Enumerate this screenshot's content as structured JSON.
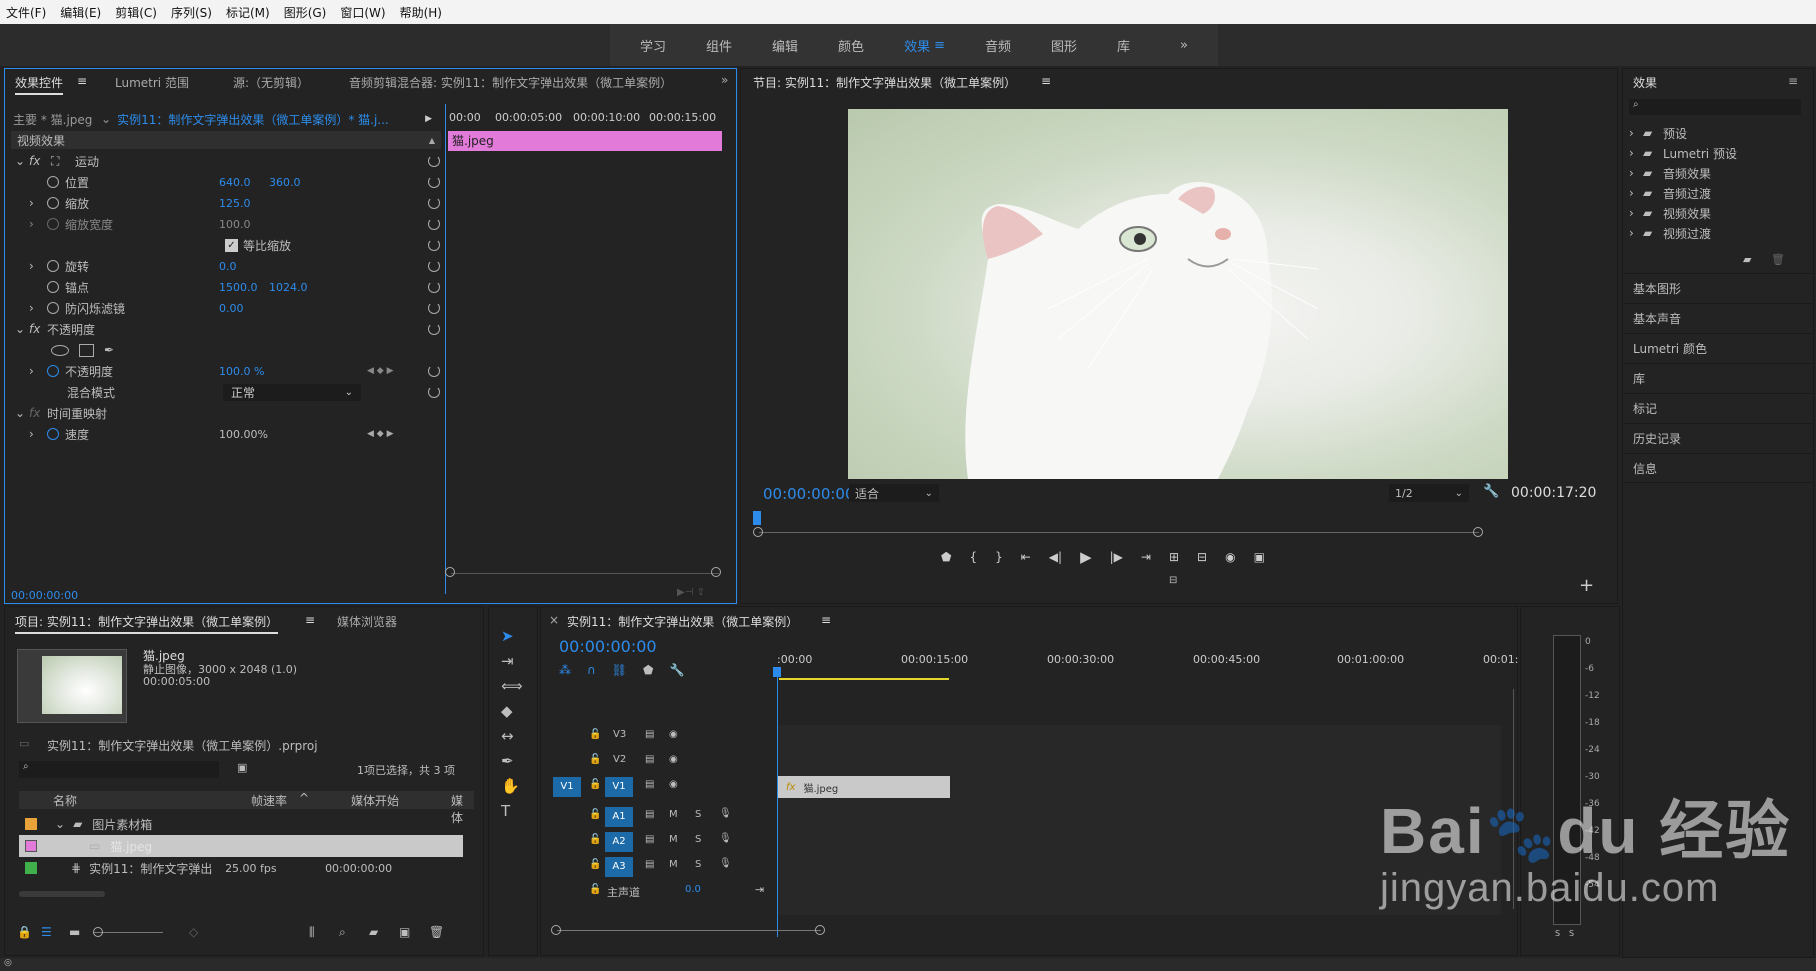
{
  "menu": [
    "文件(F)",
    "编辑(E)",
    "剪辑(C)",
    "序列(S)",
    "标记(M)",
    "图形(G)",
    "窗口(W)",
    "帮助(H)"
  ],
  "workspaces": [
    "学习",
    "组件",
    "编辑",
    "颜色",
    "效果",
    "音频",
    "图形",
    "库"
  ],
  "workspace_active": "效果",
  "ec": {
    "tabs": [
      "效果控件",
      "Lumetri 范围",
      "源:（无剪辑）",
      "音频剪辑混合器: 实例11：制作文字弹出效果（微工单案例）"
    ],
    "master": "主要 * 猫.jpeg",
    "seq": "实例11：制作文字弹出效果（微工单案例）* 猫.j...",
    "video_effects": "视频效果",
    "motion": "运动",
    "position": "位置",
    "pos_x": "640.0",
    "pos_y": "360.0",
    "scale": "缩放",
    "scale_val": "125.0",
    "scale_w": "缩放宽度",
    "scale_w_val": "100.0",
    "uniform": "等比缩放",
    "rotation": "旋转",
    "rotation_val": "0.0",
    "anchor": "锚点",
    "anchor_x": "1500.0",
    "anchor_y": "1024.0",
    "flicker": "防闪烁滤镜",
    "flicker_val": "0.00",
    "opacity_group": "不透明度",
    "opacity": "不透明度",
    "opacity_val": "100.0 %",
    "blend": "混合模式",
    "blend_val": "正常",
    "timeremap": "时间重映射",
    "speed": "速度",
    "speed_val": "100.00%",
    "timecode": "00:00:00:00",
    "ruler": [
      "00:00",
      "00:00:05:00",
      "00:00:10:00",
      "00:00:15:00"
    ],
    "clip": "猫.jpeg"
  },
  "program": {
    "title": "节目: 实例11：制作文字弹出效果（微工单案例）",
    "tc": "00:00:00:00",
    "fit": "适合",
    "res": "1/2",
    "dur": "00:00:17:20"
  },
  "effects": {
    "title": "效果",
    "items": [
      "预设",
      "Lumetri 预设",
      "音频效果",
      "音频过渡",
      "视频效果",
      "视频过渡"
    ],
    "panels": [
      "基本图形",
      "基本声音",
      "Lumetri 颜色",
      "库",
      "标记",
      "历史记录",
      "信息"
    ]
  },
  "project": {
    "tabs": [
      "项目: 实例11：制作文字弹出效果（微工单案例）",
      "媒体浏览器"
    ],
    "file": "猫.jpeg",
    "info1": "静止图像，3000 x 2048 (1.0)",
    "info2": "00:00:05:00",
    "prproj": "实例11：制作文字弹出效果（微工单案例）.prproj",
    "count": "1项已选择，共 3 项",
    "cols": [
      "名称",
      "帧速率",
      "媒体开始",
      "媒体"
    ],
    "rows": [
      {
        "name": "图片素材箱",
        "fps": "",
        "start": "",
        "color": "#e8a23a"
      },
      {
        "name": "猫.jpeg",
        "fps": "",
        "start": "",
        "color": "#e27ad9"
      },
      {
        "name": "实例11：制作文字弹出",
        "fps": "25.00 fps",
        "start": "00:00:00:00",
        "color": "#3fb04a"
      }
    ]
  },
  "timeline": {
    "title": "实例11：制作文字弹出效果（微工单案例）",
    "tc": "00:00:00:00",
    "ruler": [
      ":00:00",
      "00:00:15:00",
      "00:00:30:00",
      "00:00:45:00",
      "00:01:00:00",
      "00:01:"
    ],
    "tracks": [
      "V3",
      "V2",
      "V1",
      "A1",
      "A2",
      "A3"
    ],
    "master": "主声道",
    "master_val": "0.0",
    "clip": "猫.jpeg",
    "src": "V1"
  },
  "meter": [
    "0",
    "-6",
    "-12",
    "-18",
    "-24",
    "-30",
    "-36",
    "-42",
    "-48",
    "-54"
  ],
  "colors": {
    "accent": "#2d8ceb",
    "clip_pink": "#e27ad9",
    "clip_gray": "#c9c9c9"
  }
}
